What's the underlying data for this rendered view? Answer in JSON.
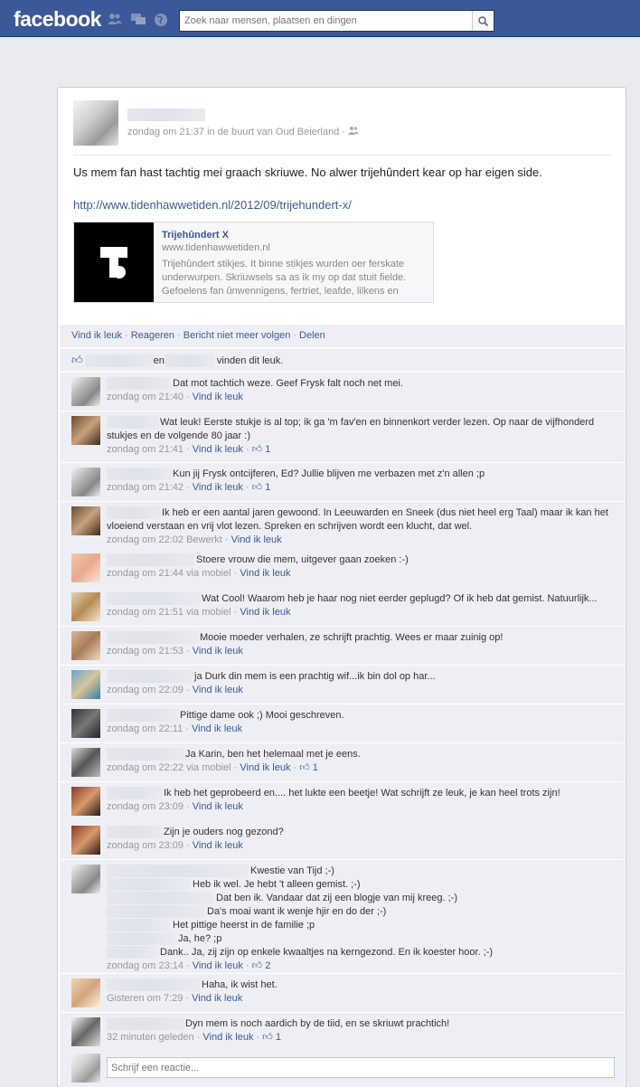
{
  "topbar": {
    "logo": "facebook",
    "search_placeholder": "Zoek naar mensen, plaatsen en dingen"
  },
  "post": {
    "meta_time": "zondag om 21:37",
    "meta_location": "in de buurt van Oud Beierland",
    "text": "Us mem fan hast tachtig mei graach skriuwe. No alwer trijehûndert kear op har eigen side.",
    "link": "http://www.tidenhawwetiden.nl/2012/09/trijehundert-x/",
    "share": {
      "title": "Trijehûndert X",
      "domain": "www.tidenhawwetiden.nl",
      "description": "Trijehûndert stikjes. It binne stikjes wurden oer ferskate underwurpen. Skriuwsels sa as ik my op dat stuit fielde. Gefoelens fan ûnwennigens, fertriet, leafde, lilkens en"
    }
  },
  "actions": {
    "like": "Vind ik leuk",
    "comment": "Reageren",
    "unfollow": "Bericht niet meer volgen",
    "share": "Delen"
  },
  "likes": {
    "and": "en",
    "text": "vinden dit leuk."
  },
  "comments": [
    {
      "text": "Dat mot tachtich weze. Geef Frysk falt noch net mei.",
      "time": "zondag om 21:40",
      "like": "Vind ik leuk",
      "likes": ""
    },
    {
      "text": "Wat leuk! Eerste stukje is al top; ik ga 'm fav'en en binnenkort verder lezen. Op naar de vijfhonderd stukjes en de volgende 80 jaar :)",
      "time": "zondag om 21:41",
      "like": "Vind ik leuk",
      "likes": "1"
    },
    {
      "text": "Kun jij Frysk ontcijferen, Ed? Jullie blijven me verbazen met z'n allen ;p",
      "time": "zondag om 21:42",
      "like": "Vind ik leuk",
      "likes": "1"
    },
    {
      "text": "Ik heb er een aantal jaren gewoond. In Leeuwarden en Sneek (dus niet heel erg Taal) maar ik kan het vloeiend verstaan en vrij vlot lezen. Spreken en schrijven wordt een klucht, dat wel.",
      "time": "zondag om 22:02",
      "extra": "Bewerkt",
      "like": "Vind ik leuk",
      "likes": ""
    },
    {
      "text": "Stoere vrouw die mem, uitgever gaan zoeken :-)",
      "time": "zondag om 21:44",
      "extra": "via mobiel",
      "like": "Vind ik leuk",
      "likes": ""
    },
    {
      "text": "Wat Cool! Waarom heb je haar nog niet eerder geplugd? Of ik heb dat gemist. Natuurlijk...",
      "time": "zondag om 21:51",
      "extra": "via mobiel",
      "like": "Vind ik leuk",
      "likes": ""
    },
    {
      "text": "Mooie moeder verhalen, ze schrijft prachtig. Wees er maar zuinig op!",
      "time": "zondag om 21:53",
      "like": "Vind ik leuk",
      "likes": ""
    },
    {
      "text": "ja Durk din mem is een prachtig wif...ik bin dol op har...",
      "time": "zondag om 22:09",
      "like": "Vind ik leuk",
      "likes": ""
    },
    {
      "text": "Pittige dame ook ;) Mooi geschreven.",
      "time": "zondag om 22:11",
      "like": "Vind ik leuk",
      "likes": ""
    },
    {
      "text": "Ja Karin, ben het helemaal met je eens.",
      "time": "zondag om 22:22",
      "extra": "via mobiel",
      "like": "Vind ik leuk",
      "likes": "1"
    },
    {
      "text": "Ik heb het geprobeerd en.... het lukte een beetje! Wat schrijft ze leuk, je kan heel trots zijn!",
      "time": "zondag om 23:09",
      "like": "Vind ik leuk",
      "likes": ""
    },
    {
      "text": "Zijn je ouders nog gezond?",
      "time": "zondag om 23:09",
      "like": "Vind ik leuk",
      "likes": ""
    },
    {
      "lines": [
        "Kwestie van Tijd ;-)",
        "Heb ik wel. Je hebt 't alleen gemist. ;-)",
        "Dat ben ik. Vandaar dat zij een blogje van mij kreeg. ;-)",
        "Da's moai want ik wenje hjir en do der ;-)",
        "Het pittige heerst in de familie ;p",
        "Ja, he? ;p",
        "Dank.. Ja, zij zijn op enkele kwaaltjes na kerngezond. En ik koester hoor. ;-)"
      ],
      "time": "zondag om 23:14",
      "like": "Vind ik leuk",
      "likes": "2"
    },
    {
      "text": "Haha, ik wist het.",
      "time": "Gisteren om 7:29",
      "like": "Vind ik leuk",
      "likes": ""
    },
    {
      "text": "Dyn mem is noch aardich by de tiid, en se skriuwt prachtich!",
      "time": "32 minuten geleden",
      "like": "Vind ik leuk",
      "likes": "1"
    }
  ],
  "reply": {
    "placeholder": "Schrijf een reactie..."
  }
}
